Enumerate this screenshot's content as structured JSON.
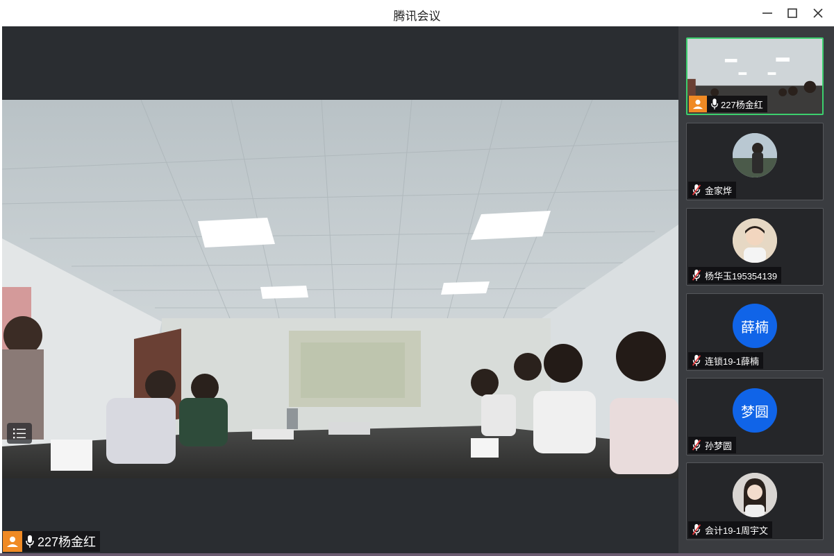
{
  "window": {
    "title": "腾讯会议"
  },
  "main_video": {
    "speaker_name": "227杨金红",
    "icons": [
      "list-icon",
      "avatar-icon",
      "microphone-icon"
    ]
  },
  "participants": [
    {
      "name": "227杨金红",
      "avatar_text": "",
      "mic": "on",
      "has_video": true,
      "active": true
    },
    {
      "name": "金家烨",
      "avatar_text": "",
      "mic": "muted",
      "has_video": false
    },
    {
      "name": "杨华玉195354139",
      "avatar_text": "",
      "mic": "muted",
      "has_video": false
    },
    {
      "name": "连锁19-1薛楠",
      "avatar_text": "薛楠",
      "mic": "muted",
      "has_video": false
    },
    {
      "name": "孙梦圆",
      "avatar_text": "梦圆",
      "mic": "muted",
      "has_video": false
    },
    {
      "name": "会计19-1周宇文",
      "avatar_text": "",
      "mic": "muted",
      "has_video": false
    }
  ],
  "colors": {
    "active_border": "#3ccf6e",
    "avatar_blue": "#1064e8",
    "badge_orange": "#f08a24",
    "background_dark": "#2a2d31"
  }
}
